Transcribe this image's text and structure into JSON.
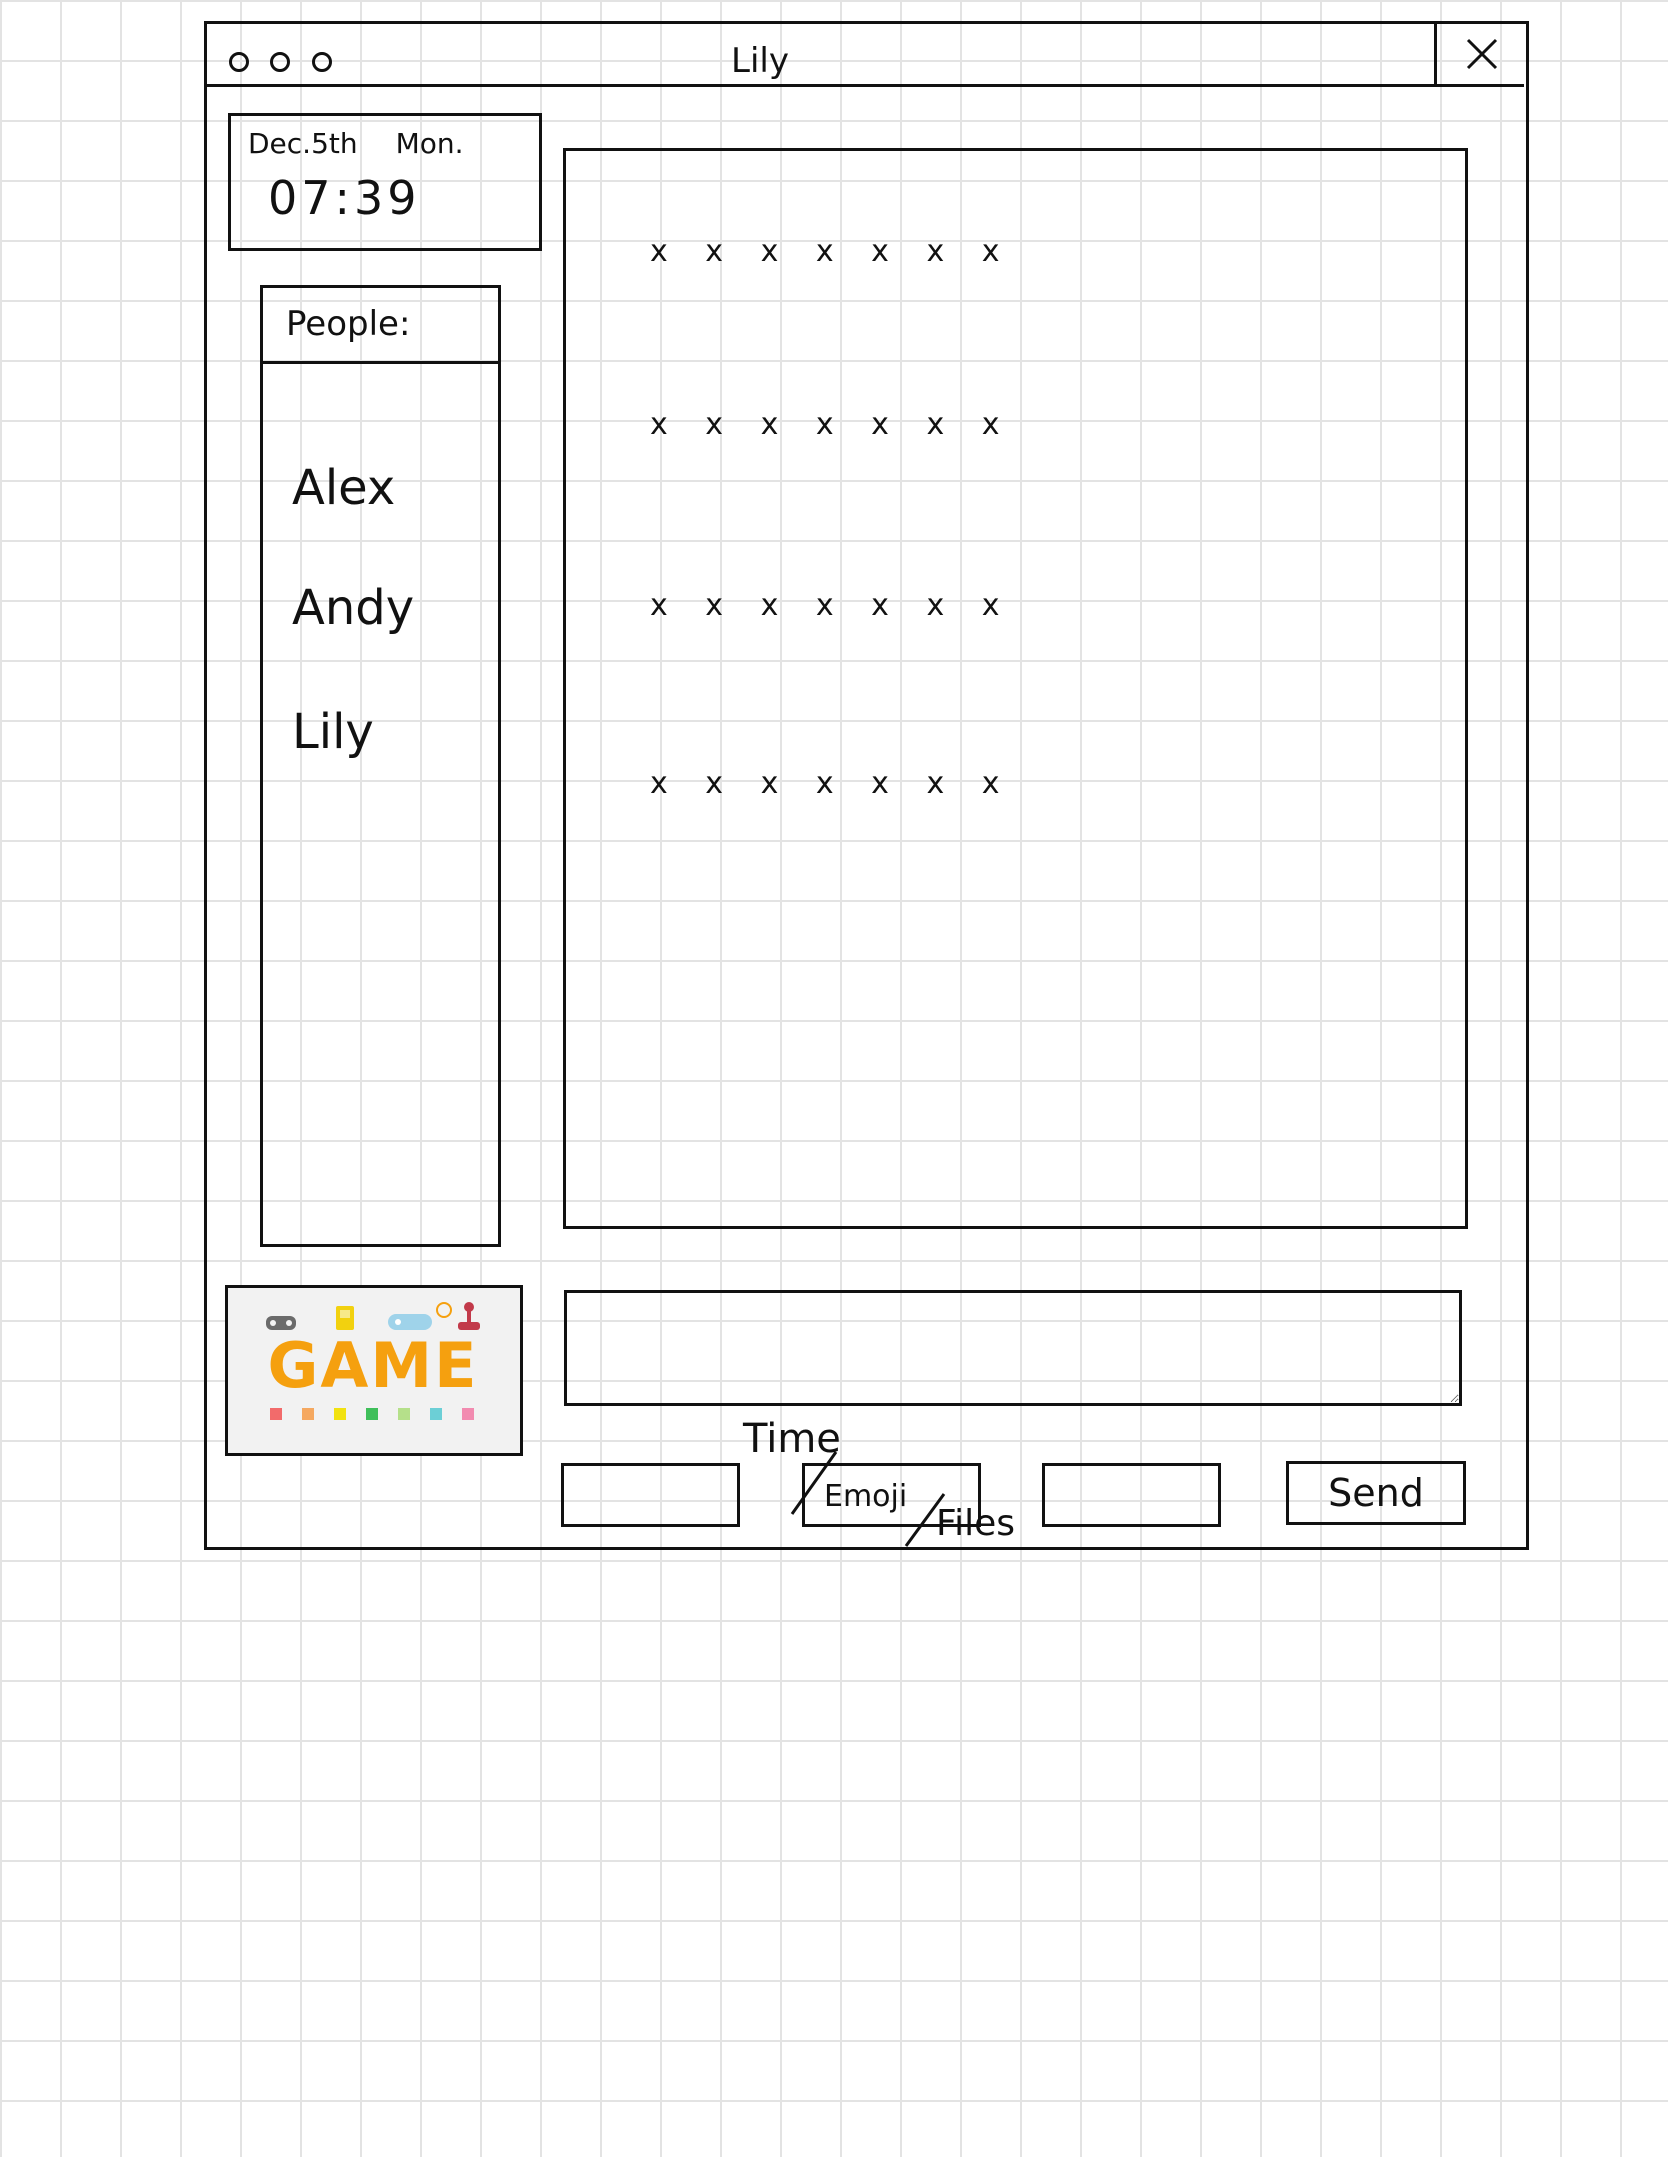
{
  "window": {
    "title": "Lily",
    "close_label": "×"
  },
  "datetime": {
    "date": "Dec.5th",
    "weekday": "Mon.",
    "time": "07:39"
  },
  "people": {
    "header": "People:",
    "items": [
      "Alex",
      "Andy",
      "Lily"
    ]
  },
  "game_logo": {
    "word": "GAME",
    "color": "#f5a00f"
  },
  "chat": {
    "messages": [
      "x x x x x x x",
      "x x x x x x x",
      "x x x x x x x",
      "x x x x x x x"
    ]
  },
  "composer": {
    "input_value": "",
    "time_label": "Time",
    "emoji_label": "Emoji",
    "files_label": "Files",
    "send_label": "Send"
  },
  "icons": [
    "window-dot-icon",
    "close-icon"
  ]
}
